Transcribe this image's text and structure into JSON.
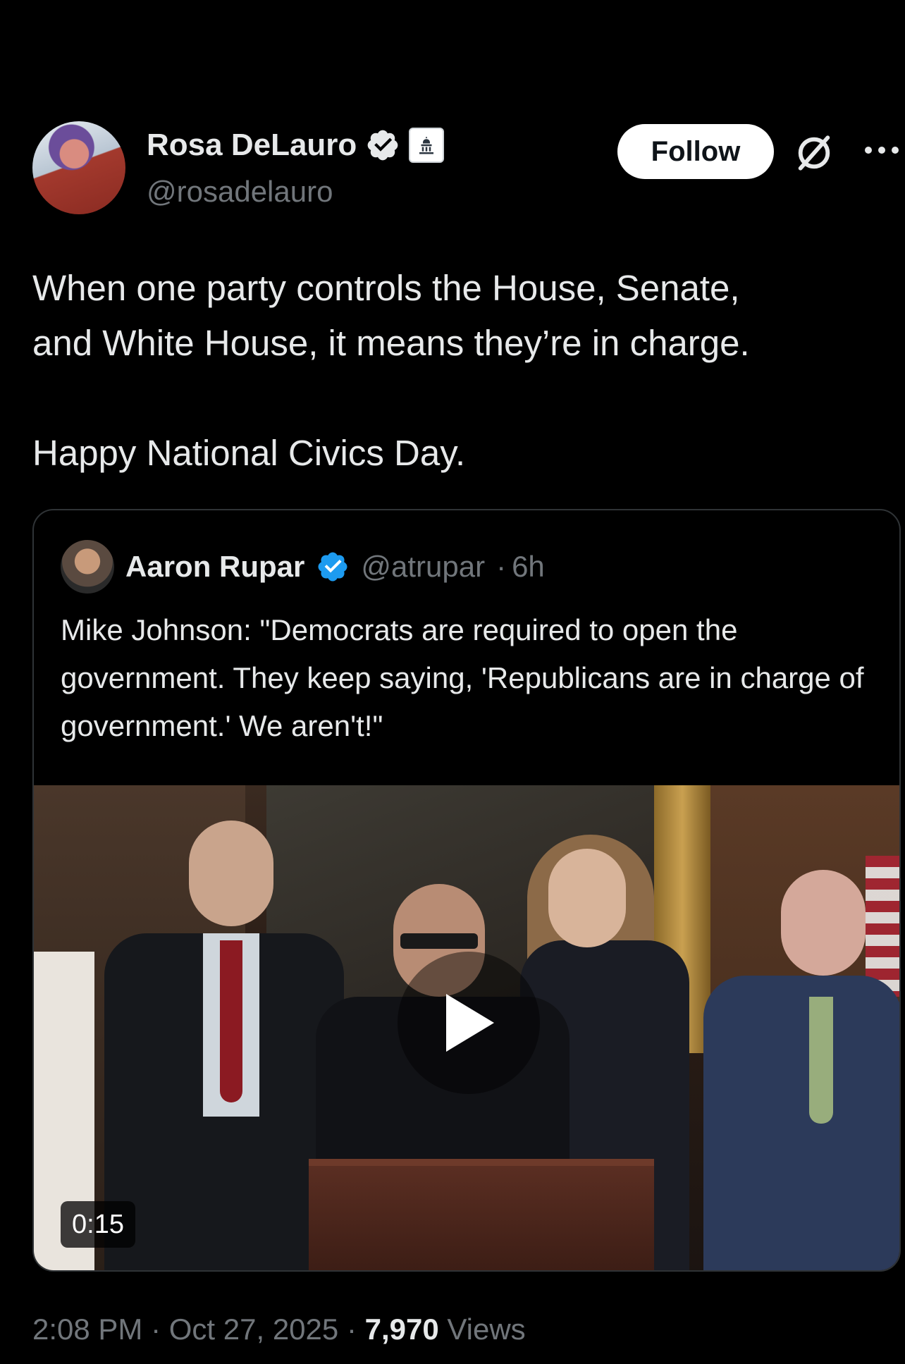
{
  "tweet": {
    "author": {
      "name": "Rosa DeLauro",
      "handle": "@rosadelauro",
      "verified": true,
      "government_badge": true
    },
    "follow_label": "Follow",
    "text_lines": [
      "When one party controls the House, Senate,",
      "and White House, it means they’re in charge.",
      "Happy National Civics Day."
    ],
    "quoted": {
      "name": "Aaron Rupar",
      "handle": "@atrupar",
      "time": "6h",
      "separator": "·",
      "text": "Mike Johnson: \"Democrats are required to open the government. They keep saying, 'Republicans are in charge of government.' We aren't!\"",
      "video_duration": "0:15"
    },
    "footer": {
      "time": "2:08 PM",
      "date": "Oct 27, 2025",
      "views_count": "7,970",
      "views_label": "Views",
      "separator": "·"
    }
  },
  "colors": {
    "background": "#000000",
    "text_primary": "#e7e9ea",
    "text_secondary": "#71767b",
    "verified_blue": "#1d9bf0",
    "border": "#2f3336"
  },
  "icons": {
    "verified": "verified-badge-icon",
    "government": "government-capitol-icon",
    "grok": "grok-icon",
    "more": "more-options-icon",
    "play": "play-icon"
  }
}
